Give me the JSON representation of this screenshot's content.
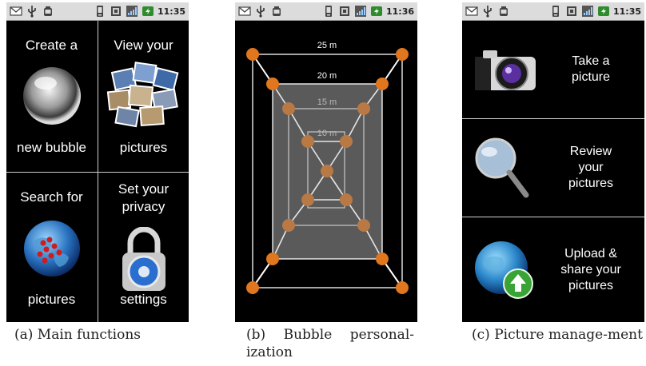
{
  "statusbars": [
    {
      "time": "11:35"
    },
    {
      "time": "11:36"
    },
    {
      "time": "11:35"
    }
  ],
  "main_functions": {
    "create": {
      "line1": "Create a",
      "line2": "new bubble"
    },
    "view": {
      "line1": "View your",
      "line2": "pictures"
    },
    "search": {
      "line1": "Search for",
      "line2": "pictures"
    },
    "privacy": {
      "line1": "Set your",
      "line2": "privacy",
      "line3": "settings"
    }
  },
  "bubble": {
    "distances": [
      "25 m",
      "20 m",
      "15 m",
      "10 m"
    ]
  },
  "picture_management": {
    "take": [
      "Take a",
      "picture"
    ],
    "review": [
      "Review",
      "your",
      "pictures"
    ],
    "upload": [
      "Upload &",
      "share your",
      "pictures"
    ]
  },
  "captions": {
    "a": "(a) Main functions",
    "b": "(b) Bubble personal-ization",
    "c": "(c) Picture manage-ment"
  }
}
